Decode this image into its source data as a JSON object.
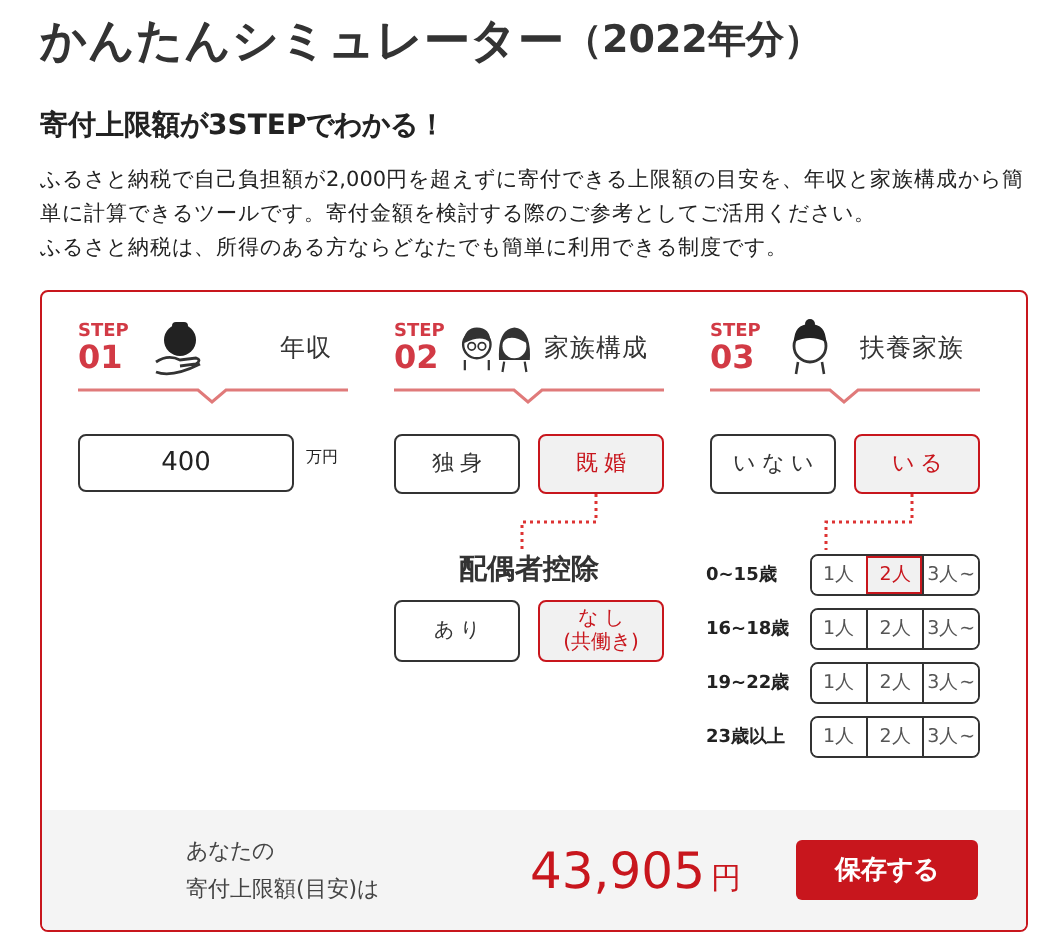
{
  "title": {
    "main": "かんたんシミュレーター",
    "sub": "（2022年分）"
  },
  "heading": "寄付上限額が3STEPでわかる！",
  "paragraphs": [
    "ふるさと納税で自己負担額が2,000円を超えずに寄付できる上限額の目安を、年収と家族構成から簡単に計算できるツールです。寄付金額を検討する際のご参考としてご活用ください。",
    "ふるさと納税は、所得のある方ならどなたでも簡単に利用できる制度です。"
  ],
  "steps": [
    {
      "label": "STEP",
      "number": "01",
      "title": "年収",
      "kind": "hand"
    },
    {
      "label": "STEP",
      "number": "02",
      "title": "家族構成",
      "kind": "couple"
    },
    {
      "label": "STEP",
      "number": "03",
      "title": "扶養家族",
      "kind": "child"
    }
  ],
  "income": {
    "value": "400",
    "unit": "万円"
  },
  "marital": [
    {
      "label": "独 身",
      "selected": false
    },
    {
      "label": "既 婚",
      "selected": true
    }
  ],
  "spouse_deduction": {
    "title": "配偶者控除",
    "options": [
      {
        "label": "あ り",
        "selected": false
      },
      {
        "label": "な し",
        "note": "(共働き)",
        "selected": true
      }
    ]
  },
  "dependents": [
    {
      "label": "い な い",
      "selected": false
    },
    {
      "label": "い る",
      "selected": true
    }
  ],
  "age_groups": [
    {
      "label": "0~15歳",
      "counts": [
        {
          "label": "1人",
          "selected": false
        },
        {
          "label": "2人",
          "selected": true
        },
        {
          "label": "3人~",
          "selected": false
        }
      ]
    },
    {
      "label": "16~18歳",
      "counts": [
        {
          "label": "1人",
          "selected": false
        },
        {
          "label": "2人",
          "selected": false
        },
        {
          "label": "3人~",
          "selected": false
        }
      ]
    },
    {
      "label": "19~22歳",
      "counts": [
        {
          "label": "1人",
          "selected": false
        },
        {
          "label": "2人",
          "selected": false
        },
        {
          "label": "3人~",
          "selected": false
        }
      ]
    },
    {
      "label": "23歳以上",
      "counts": [
        {
          "label": "1人",
          "selected": false
        },
        {
          "label": "2人",
          "selected": false
        },
        {
          "label": "3人~",
          "selected": false
        }
      ]
    }
  ],
  "result": {
    "label_lines": [
      "あなたの",
      "寄付上限額(目安)は"
    ],
    "amount": "43,905",
    "unit": "円"
  },
  "save_button": "保存する"
}
